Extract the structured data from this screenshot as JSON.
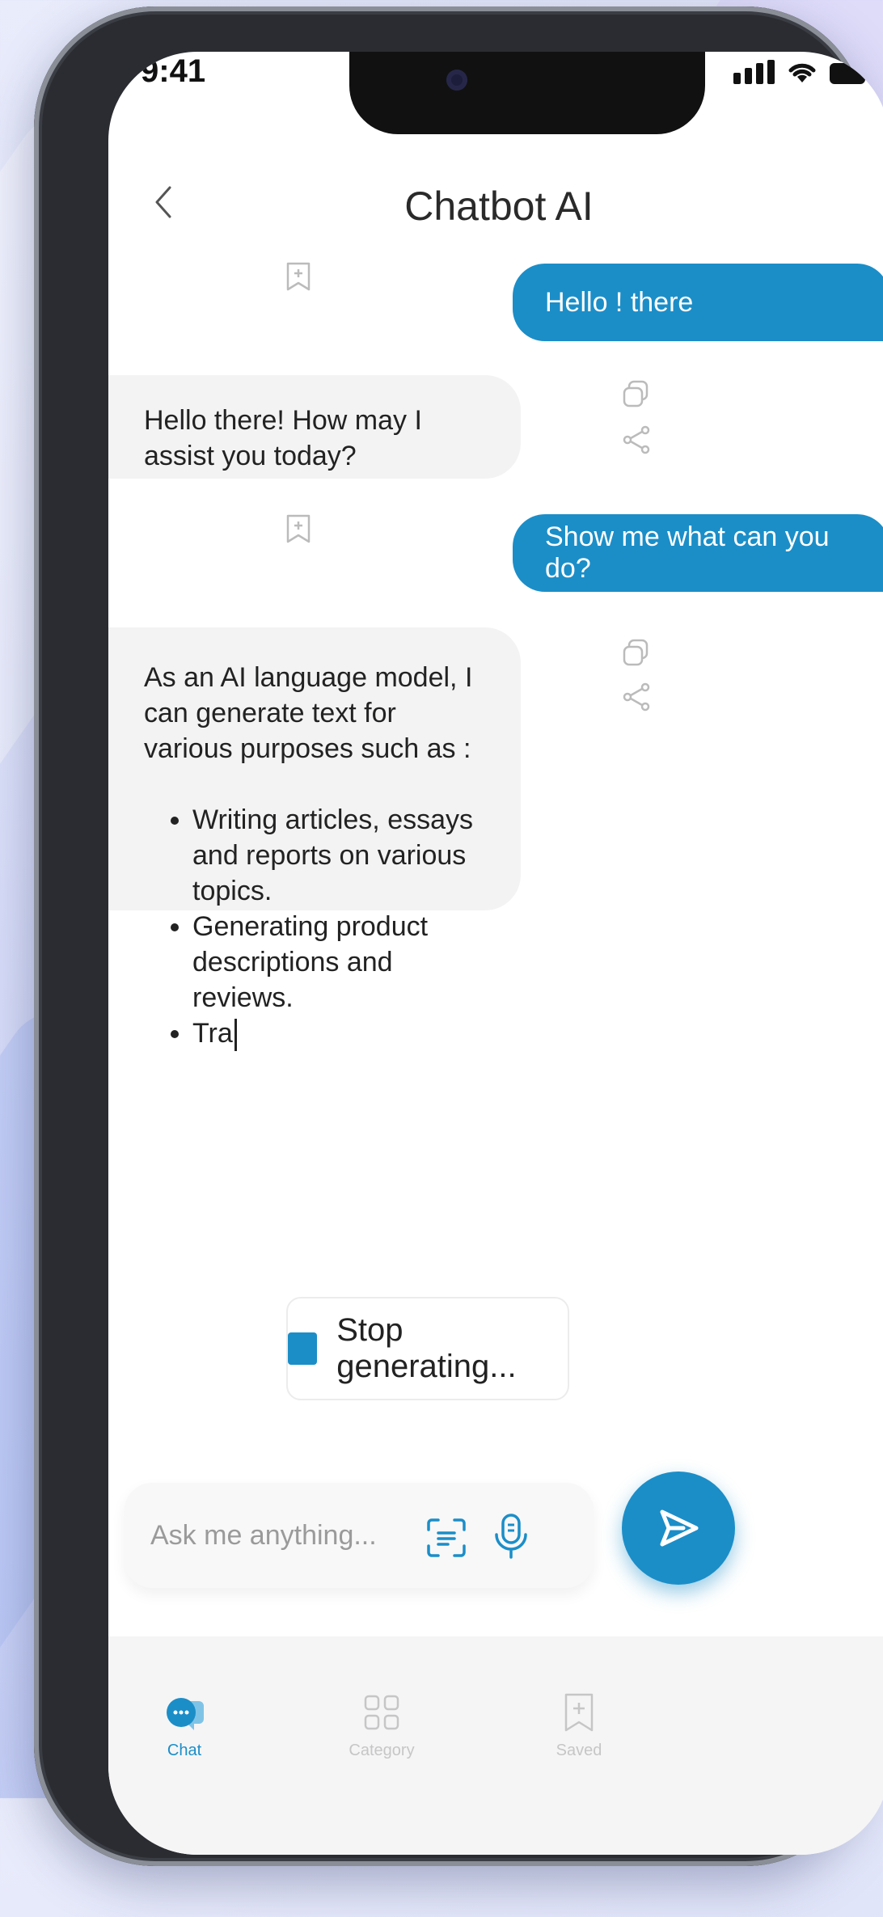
{
  "status_bar": {
    "time": "9:41"
  },
  "header": {
    "title": "Chatbot AI"
  },
  "messages": [
    {
      "role": "user",
      "text": "Hello ! there"
    },
    {
      "role": "bot",
      "text": "Hello there! How may I assist you today?"
    },
    {
      "role": "user",
      "text": "Show me what can you do?"
    },
    {
      "role": "bot",
      "intro": "As an AI language model, I can generate text for various purposes such as :",
      "bullets": [
        "Writing articles, essays and reports on various topics.",
        "Generating product descriptions and reviews.",
        "Tra"
      ]
    }
  ],
  "stop_button": {
    "label": "Stop generating..."
  },
  "composer": {
    "placeholder": "Ask me anything..."
  },
  "bottom_nav": {
    "items": [
      {
        "label": "Chat",
        "active": true
      },
      {
        "label": "Category",
        "active": false
      },
      {
        "label": "Saved",
        "active": false
      }
    ]
  },
  "colors": {
    "accent": "#1b8ec8",
    "bot_bubble": "#f3f3f4",
    "nav_inactive": "#c6c6c6"
  }
}
